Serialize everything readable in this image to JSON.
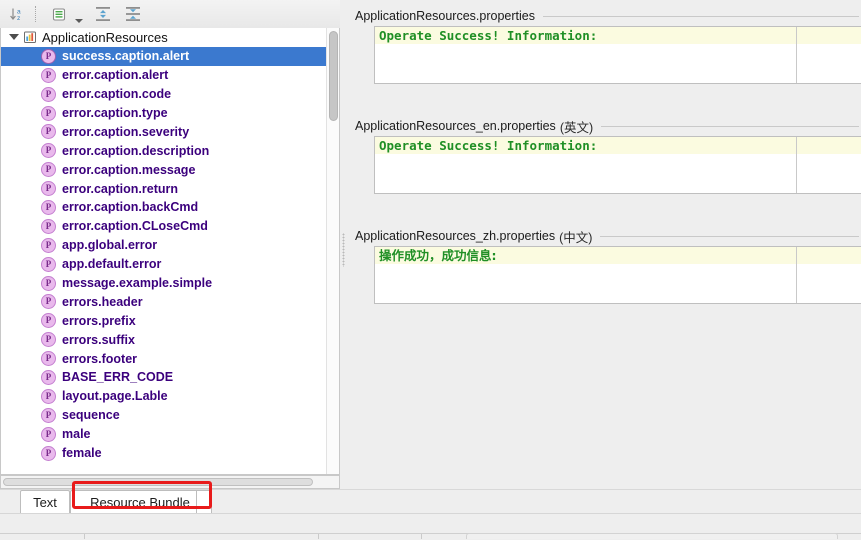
{
  "toolbar": {
    "buttons": [
      {
        "name": "sort-alphabetically",
        "title": "Sort Alphabetically"
      },
      {
        "name": "group-by-prefix",
        "title": "Group by Prefix"
      },
      {
        "name": "expand-all",
        "title": "Expand All"
      },
      {
        "name": "collapse-all",
        "title": "Collapse All"
      }
    ]
  },
  "tree": {
    "root": {
      "label": "ApplicationResources",
      "icon": "resource-bundle-icon",
      "expanded": true
    },
    "items": [
      {
        "label": "success.caption.alert",
        "icon": "P",
        "selected": true
      },
      {
        "label": "error.caption.alert",
        "icon": "P",
        "selected": false
      },
      {
        "label": "error.caption.code",
        "icon": "P",
        "selected": false
      },
      {
        "label": "error.caption.type",
        "icon": "P",
        "selected": false
      },
      {
        "label": "error.caption.severity",
        "icon": "P",
        "selected": false
      },
      {
        "label": "error.caption.description",
        "icon": "P",
        "selected": false
      },
      {
        "label": "error.caption.message",
        "icon": "P",
        "selected": false
      },
      {
        "label": "error.caption.return",
        "icon": "P",
        "selected": false
      },
      {
        "label": "error.caption.backCmd",
        "icon": "P",
        "selected": false
      },
      {
        "label": "error.caption.CLoseCmd",
        "icon": "P",
        "selected": false
      },
      {
        "label": "app.global.error",
        "icon": "P",
        "selected": false
      },
      {
        "label": "app.default.error",
        "icon": "P",
        "selected": false
      },
      {
        "label": "message.example.simple",
        "icon": "P",
        "selected": false
      },
      {
        "label": "errors.header",
        "icon": "P",
        "selected": false
      },
      {
        "label": "errors.prefix",
        "icon": "P",
        "selected": false
      },
      {
        "label": "errors.suffix",
        "icon": "P",
        "selected": false
      },
      {
        "label": "errors.footer",
        "icon": "P",
        "selected": false
      },
      {
        "label": "BASE_ERR_CODE",
        "icon": "P",
        "selected": false
      },
      {
        "label": "layout.page.Lable",
        "icon": "P",
        "selected": false
      },
      {
        "label": "sequence",
        "icon": "P",
        "selected": false
      },
      {
        "label": "male",
        "icon": "P",
        "selected": false
      },
      {
        "label": "female",
        "icon": "P",
        "selected": false
      }
    ],
    "selection_color": "#3b79cf",
    "item_text_color": "#3b007d"
  },
  "sections": [
    {
      "file": "ApplicationResources.properties",
      "lang": "",
      "value": "Operate Success! Information:",
      "value_color": "#1f8f25",
      "highlight_color": "#fbfbe0",
      "cjk": false
    },
    {
      "file": "ApplicationResources_en.properties",
      "lang": "(英文)",
      "value": "Operate Success! Information:",
      "value_color": "#1f8f25",
      "highlight_color": "#fbfbe0",
      "cjk": false
    },
    {
      "file": "ApplicationResources_zh.properties",
      "lang": "(中文)",
      "value": "操作成功，成功信息:",
      "value_color": "#1f8f25",
      "highlight_color": "#fbfbe0",
      "cjk": true
    }
  ],
  "tabs": {
    "items": [
      {
        "label": "Text",
        "active": false
      },
      {
        "label": "Resource Bundle",
        "active": true
      }
    ]
  },
  "annotation": {
    "type": "rectangle",
    "color": "#e81b1b",
    "targets": "Resource Bundle"
  }
}
